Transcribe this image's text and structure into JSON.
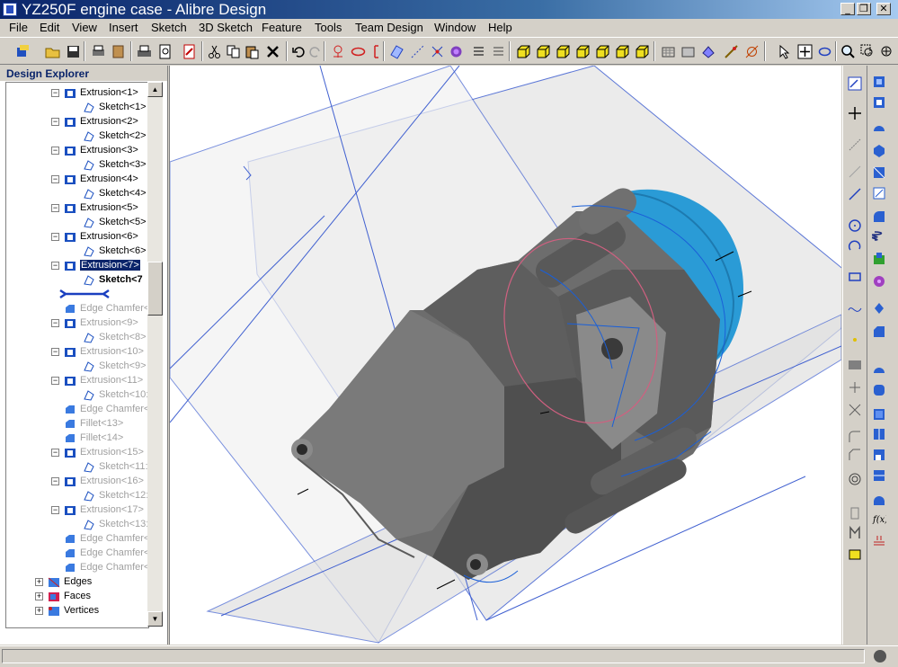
{
  "window": {
    "title": "YZ250F engine case - Alibre Design",
    "minimize": "_",
    "restore": "❐",
    "close": "✕"
  },
  "menu": [
    "File",
    "Edit",
    "View",
    "Insert",
    "Sketch",
    "3D Sketch",
    "Feature",
    "Tools",
    "Team Design",
    "Window",
    "Help"
  ],
  "explorer": {
    "title": "Design Explorer",
    "nodes": [
      {
        "label": "Extrusion<1>",
        "kind": "extrusion",
        "level": 1,
        "state": "normal"
      },
      {
        "label": "Sketch<1>",
        "kind": "sketch",
        "level": 2,
        "state": "normal"
      },
      {
        "label": "Extrusion<2>",
        "kind": "extrusion",
        "level": 1,
        "state": "normal"
      },
      {
        "label": "Sketch<2>",
        "kind": "sketch",
        "level": 2,
        "state": "normal"
      },
      {
        "label": "Extrusion<3>",
        "kind": "extrusion",
        "level": 1,
        "state": "normal"
      },
      {
        "label": "Sketch<3>",
        "kind": "sketch",
        "level": 2,
        "state": "normal"
      },
      {
        "label": "Extrusion<4>",
        "kind": "extrusion",
        "level": 1,
        "state": "normal"
      },
      {
        "label": "Sketch<4>",
        "kind": "sketch",
        "level": 2,
        "state": "normal"
      },
      {
        "label": "Extrusion<5>",
        "kind": "extrusion",
        "level": 1,
        "state": "normal"
      },
      {
        "label": "Sketch<5>",
        "kind": "sketch",
        "level": 2,
        "state": "normal"
      },
      {
        "label": "Extrusion<6>",
        "kind": "extrusion",
        "level": 1,
        "state": "normal"
      },
      {
        "label": "Sketch<6>",
        "kind": "sketch",
        "level": 2,
        "state": "normal"
      },
      {
        "label": "Extrusion<7>",
        "kind": "extrusion",
        "level": 1,
        "state": "selected"
      },
      {
        "label": "Sketch<7",
        "kind": "sketch",
        "level": 2,
        "state": "bold"
      },
      {
        "label": "",
        "kind": "rollback",
        "level": 0,
        "state": "marker"
      },
      {
        "label": "Edge Chamfer<",
        "kind": "chamfer",
        "level": 1,
        "state": "dim"
      },
      {
        "label": "Extrusion<9>",
        "kind": "extrusion",
        "level": 1,
        "state": "dim"
      },
      {
        "label": "Sketch<8>",
        "kind": "sketch",
        "level": 2,
        "state": "dim"
      },
      {
        "label": "Extrusion<10>",
        "kind": "extrusion",
        "level": 1,
        "state": "dim"
      },
      {
        "label": "Sketch<9>",
        "kind": "sketch",
        "level": 2,
        "state": "dim"
      },
      {
        "label": "Extrusion<11>",
        "kind": "extrusion",
        "level": 1,
        "state": "dim"
      },
      {
        "label": "Sketch<10:",
        "kind": "sketch",
        "level": 2,
        "state": "dim"
      },
      {
        "label": "Edge Chamfer<",
        "kind": "chamfer",
        "level": 1,
        "state": "dim"
      },
      {
        "label": "Fillet<13>",
        "kind": "chamfer",
        "level": 1,
        "state": "dim"
      },
      {
        "label": "Fillet<14>",
        "kind": "chamfer",
        "level": 1,
        "state": "dim"
      },
      {
        "label": "Extrusion<15>",
        "kind": "extrusion",
        "level": 1,
        "state": "dim"
      },
      {
        "label": "Sketch<11:",
        "kind": "sketch",
        "level": 2,
        "state": "dim"
      },
      {
        "label": "Extrusion<16>",
        "kind": "extrusion",
        "level": 1,
        "state": "dim"
      },
      {
        "label": "Sketch<12:",
        "kind": "sketch",
        "level": 2,
        "state": "dim"
      },
      {
        "label": "Extrusion<17>",
        "kind": "extrusion",
        "level": 1,
        "state": "dim"
      },
      {
        "label": "Sketch<13:",
        "kind": "sketch",
        "level": 2,
        "state": "dim"
      },
      {
        "label": "Edge Chamfer<",
        "kind": "chamfer",
        "level": 1,
        "state": "dim"
      },
      {
        "label": "Edge Chamfer<",
        "kind": "chamfer",
        "level": 1,
        "state": "dim"
      },
      {
        "label": "Edge Chamfer<",
        "kind": "chamfer",
        "level": 1,
        "state": "dim"
      },
      {
        "label": "Edges",
        "kind": "edges",
        "level": 0,
        "state": "normal"
      },
      {
        "label": "Faces",
        "kind": "faces",
        "level": 0,
        "state": "normal"
      },
      {
        "label": "Vertices",
        "kind": "vertices",
        "level": 0,
        "state": "normal"
      }
    ]
  },
  "colors": {
    "title_bar": "#0a246a",
    "selection": "#0a246a",
    "sketch_blue": "#1a5fd8",
    "model_gray": "#6f6f6f",
    "highlight_blue": "#2aa0d8"
  }
}
